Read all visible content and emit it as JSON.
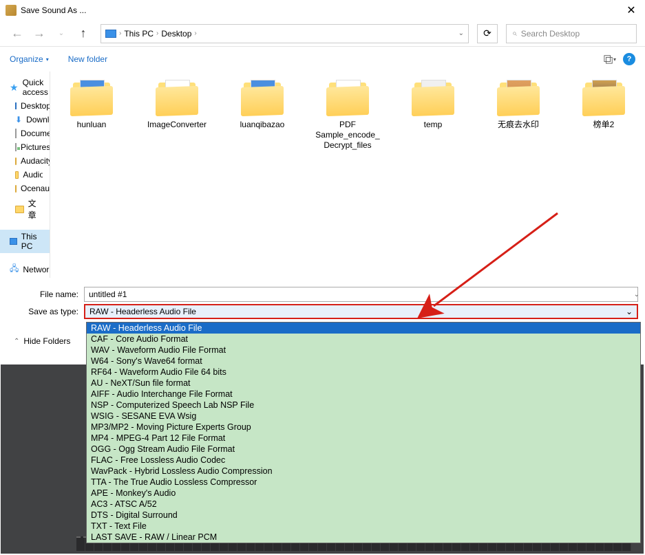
{
  "title": "Save Sound As ...",
  "breadcrumb": {
    "item1": "This PC",
    "item2": "Desktop"
  },
  "search": {
    "placeholder": "Search Desktop"
  },
  "toolbar": {
    "organize": "Organize",
    "new_folder": "New folder"
  },
  "sidebar": {
    "quick_access": "Quick access",
    "desktop": "Desktop",
    "downloads": "Downloads",
    "documents": "Documents",
    "pictures": "Pictures",
    "audacity": "Audacity",
    "audio_rec": "Audio Recorder pgr",
    "ocenaudio": "Ocenaudio",
    "wenzhang": "文章",
    "this_pc": "This PC",
    "network": "Network"
  },
  "tiles": [
    "hunluan",
    "ImageConverter",
    "luanqibazao",
    "PDF Sample_encode_Decrypt_files",
    "temp",
    "无痕去水印",
    "榜单2"
  ],
  "form": {
    "file_name_label": "File name:",
    "file_name_value": "untitled #1",
    "save_type_label": "Save as type:",
    "save_type_value": "RAW - Headerless Audio File"
  },
  "hide_folders": "Hide Folders",
  "dropdown": [
    "RAW - Headerless Audio File",
    "CAF - Core Audio Format",
    "WAV - Waveform Audio File Format",
    "W64 - Sony's Wave64 format",
    "RF64 - Waveform Audio File 64 bits",
    "AU - NeXT/Sun file format",
    "AIFF - Audio Interchange File Format",
    "NSP - Computerized Speech Lab NSP File",
    "WSIG - SESANE EVA Wsig",
    "MP3/MP2 - Moving Picture Experts Group",
    "MP4 - MPEG-4 Part 12 File Format",
    "OGG - Ogg Stream Audio File Format",
    "FLAC - Free Lossless Audio Codec",
    "WavPack - Hybrid Lossless Audio Compression",
    "TTA - The True Audio Lossless Compressor",
    "APE - Monkey's Audio",
    "AC3 - ATSC A/52",
    "DTS - Digital Surround",
    "TXT - Text File",
    "LAST SAVE - RAW / Linear PCM"
  ]
}
